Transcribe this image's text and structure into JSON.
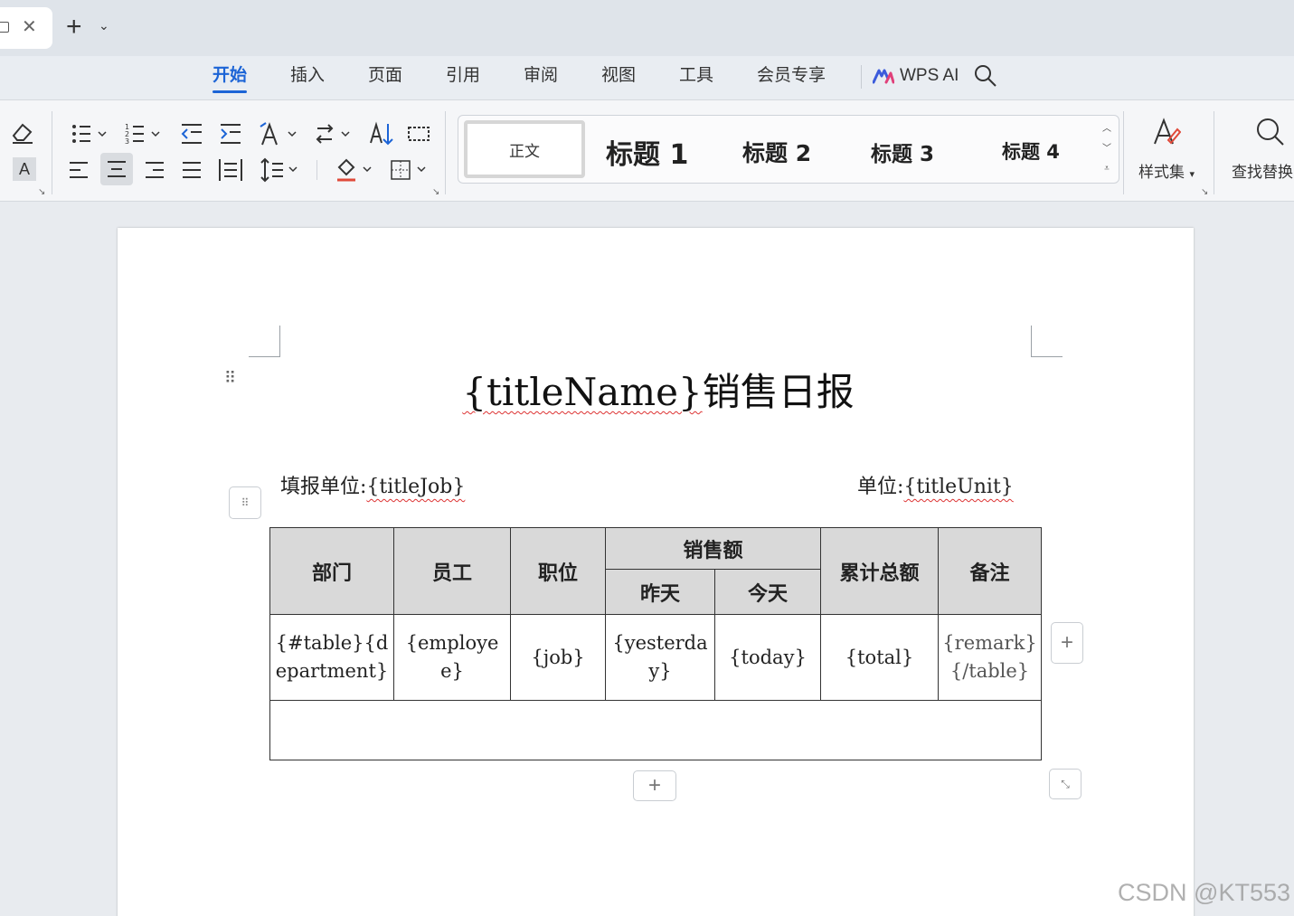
{
  "tabbar": {
    "new_tab_label": "+",
    "new_tab_more": "⌄"
  },
  "menu": {
    "tabs": [
      "开始",
      "插入",
      "页面",
      "引用",
      "审阅",
      "视图",
      "工具",
      "会员专享"
    ],
    "active_index": 0,
    "ai_label": "WPS AI"
  },
  "toolbar": {
    "font_color_letter": "A",
    "styles": {
      "normal": "正文",
      "h1": "标题 1",
      "h2": "标题 2",
      "h3": "标题 3",
      "h4": "标题 4"
    },
    "style_set_label": "样式集",
    "find_replace_label": "查找替换"
  },
  "document": {
    "title_var": "{titleName}",
    "title_text": "销售日报",
    "fill_unit_label": "填报单位:",
    "fill_unit_var": "{titleJob}",
    "unit_label": "单位:",
    "unit_var": "{titleUnit}",
    "table": {
      "headers": {
        "dept": "部门",
        "employee": "员工",
        "position": "职位",
        "sales": "销售额",
        "yesterday": "昨天",
        "today": "今天",
        "total": "累计总额",
        "remark": "备注"
      },
      "row": {
        "dept": "{#table}{department}",
        "employee": "{employee}",
        "position": "{job}",
        "yesterday": "{yesterday}",
        "today": "{today}",
        "total": "{total}",
        "remark": "{remark}{/table}"
      }
    }
  },
  "watermark": "CSDN @KT553",
  "colors": {
    "accent": "#1c64d6",
    "header_fill": "#d9d9d9"
  }
}
